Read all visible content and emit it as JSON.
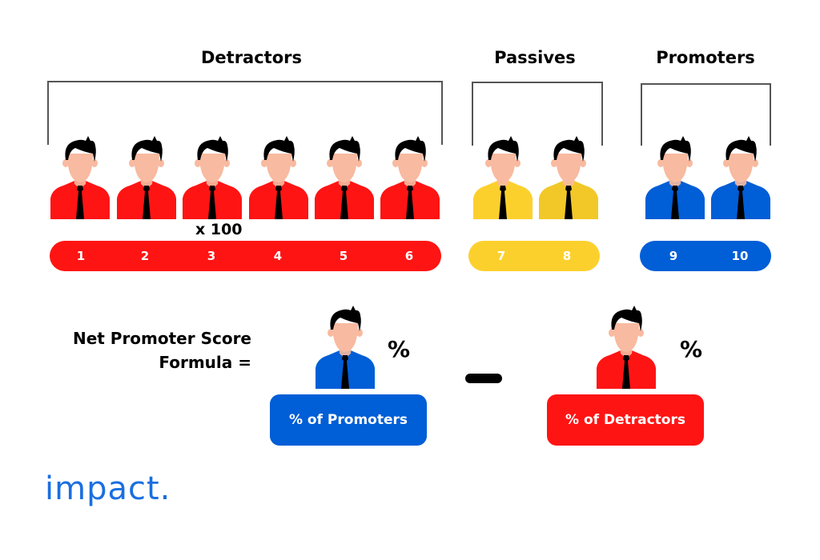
{
  "colors": {
    "detractor": "#ff1414",
    "passive": "#fcd02c",
    "passive_alt": "#f2c828",
    "promoter": "#005ed6",
    "skin": "#f8baa0",
    "hair": "#000000",
    "bracket": "#555555",
    "logo": "#1a6fe0"
  },
  "groups": [
    {
      "label": "Detractors",
      "scores": [
        "1",
        "2",
        "3",
        "4",
        "5",
        "6"
      ]
    },
    {
      "label": "Passives",
      "scores": [
        "7",
        "8"
      ]
    },
    {
      "label": "Promoters",
      "scores": [
        "9",
        "10"
      ]
    }
  ],
  "multiplier": "x 100",
  "formula": {
    "label_line1": "Net Promoter Score",
    "label_line2": "Formula =",
    "left_percent": "%",
    "right_percent": "%",
    "left_box": "% of Promoters",
    "right_box": "% of Detractors",
    "operator": "minus"
  },
  "logo": "impact."
}
